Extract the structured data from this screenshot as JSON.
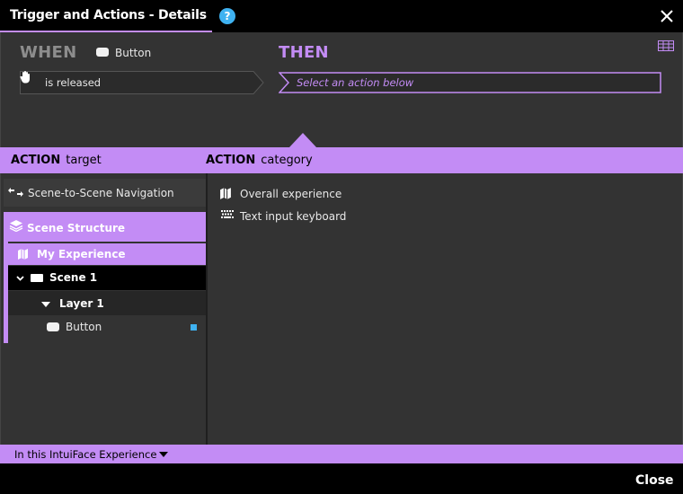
{
  "window": {
    "title": "Trigger and Actions - Details",
    "help_glyph": "?"
  },
  "trigger": {
    "when_label": "WHEN",
    "source_label": "Button",
    "event_label": "is released"
  },
  "action": {
    "then_label": "THEN",
    "placeholder": "Select an action below"
  },
  "headers": {
    "target_bold": "ACTION",
    "target_text": "target",
    "category_bold": "ACTION",
    "category_text": "category"
  },
  "targets": {
    "navigation_label": "Scene-to-Scene Navigation",
    "structure_label": "Scene Structure",
    "tree": {
      "experience": "My Experience",
      "scene": "Scene 1",
      "layer": "Layer 1",
      "item": "Button"
    }
  },
  "categories": [
    {
      "label": "Overall experience",
      "icon": "map-icon"
    },
    {
      "label": "Text input keyboard",
      "icon": "keyboard-icon"
    }
  ],
  "scope_selector": {
    "label": "In this IntuiFace Experience"
  },
  "footer": {
    "close_label": "Close"
  },
  "colors": {
    "accent": "#c38cf5",
    "panel": "#333333",
    "badge": "#3fb2f1"
  }
}
